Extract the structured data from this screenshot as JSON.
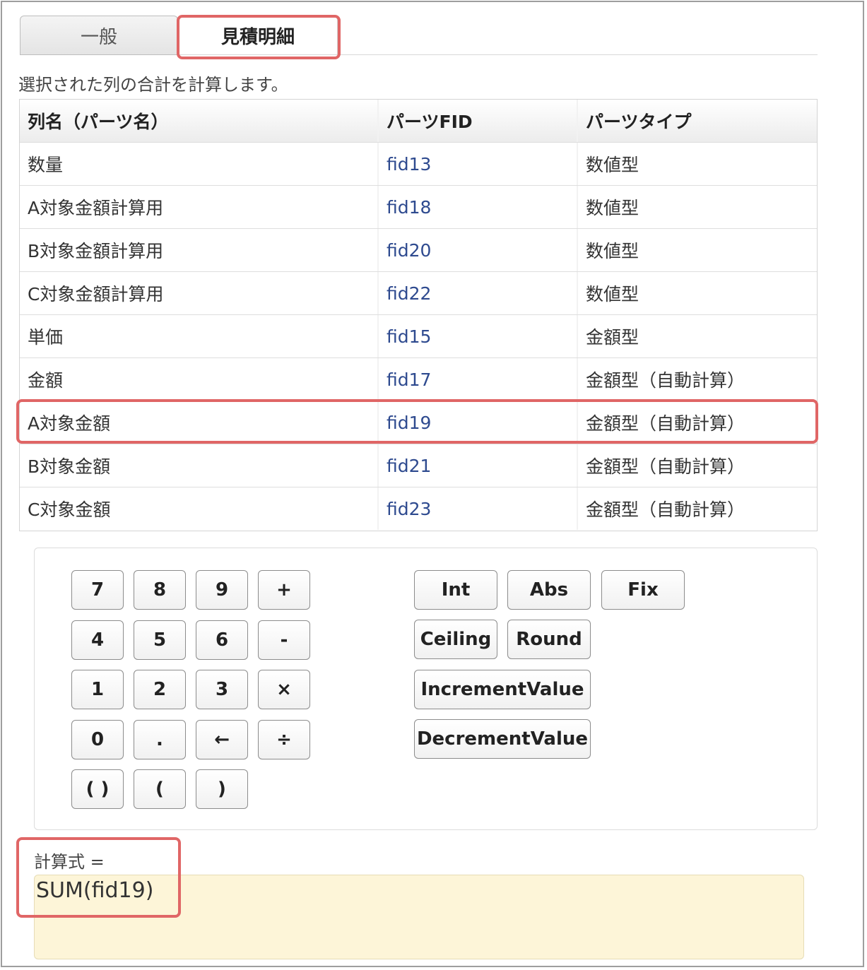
{
  "tabs": {
    "general": "一般",
    "estimate_detail": "見積明細"
  },
  "description": "選択された列の合計を計算します。",
  "table": {
    "headers": [
      "列名（パーツ名）",
      "パーツFID",
      "パーツタイプ"
    ],
    "rows": [
      {
        "name": "数量",
        "fid": "fid13",
        "type": "数値型"
      },
      {
        "name": "A対象金額計算用",
        "fid": "fid18",
        "type": "数値型"
      },
      {
        "name": "B対象金額計算用",
        "fid": "fid20",
        "type": "数値型"
      },
      {
        "name": "C対象金額計算用",
        "fid": "fid22",
        "type": "数値型"
      },
      {
        "name": "単価",
        "fid": "fid15",
        "type": "金額型"
      },
      {
        "name": "金額",
        "fid": "fid17",
        "type": "金額型（自動計算）"
      },
      {
        "name": "A対象金額",
        "fid": "fid19",
        "type": "金額型（自動計算）"
      },
      {
        "name": "B対象金額",
        "fid": "fid21",
        "type": "金額型（自動計算）"
      },
      {
        "name": "C対象金額",
        "fid": "fid23",
        "type": "金額型（自動計算）"
      }
    ]
  },
  "keypad": {
    "keys": [
      "7",
      "8",
      "9",
      "+",
      "4",
      "5",
      "6",
      "-",
      "1",
      "2",
      "3",
      "×",
      "0",
      ".",
      "←",
      "÷",
      "( )",
      "(",
      ")"
    ]
  },
  "functions": {
    "int": "Int",
    "abs": "Abs",
    "fix": "Fix",
    "ceiling": "Ceiling",
    "round": "Round",
    "increment": "IncrementValue",
    "decrement": "DecrementValue"
  },
  "formula": {
    "label": "計算式 =",
    "value": "SUM(fid19)"
  },
  "colors": {
    "highlight": "#e06666",
    "fid_text": "#2e4a8f",
    "formula_bg": "#fdf5d8"
  }
}
